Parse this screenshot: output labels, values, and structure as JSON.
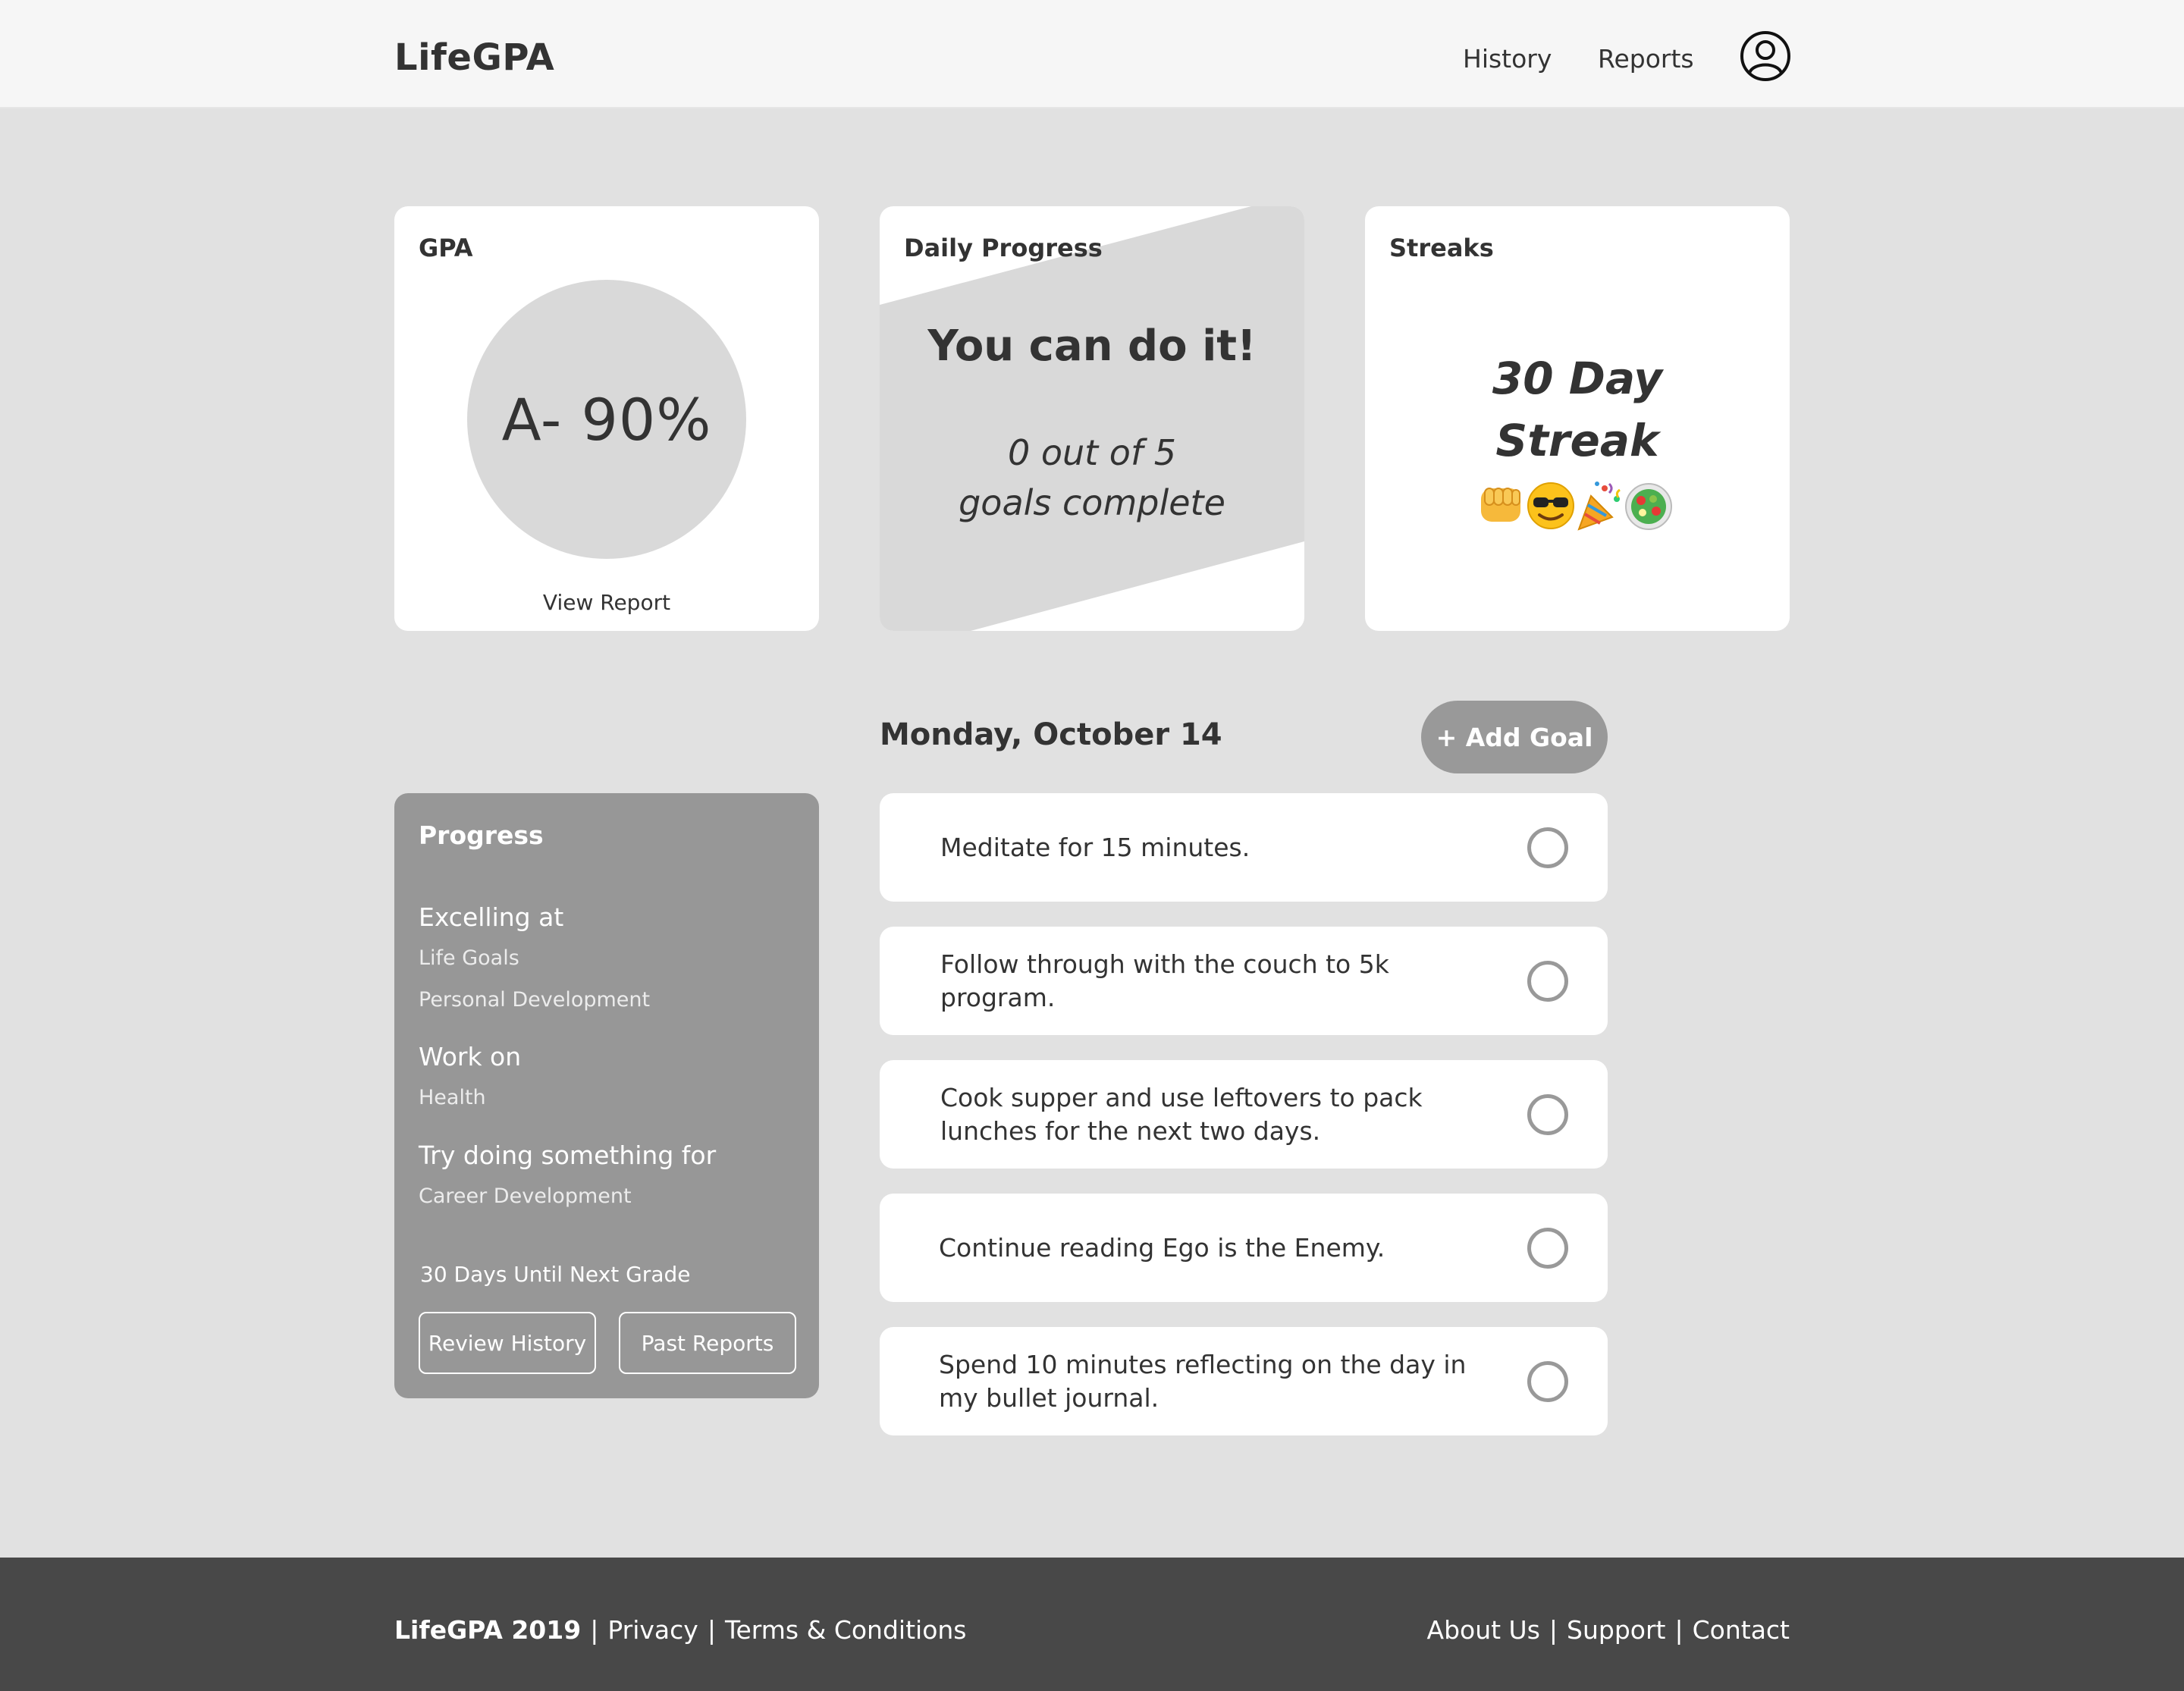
{
  "header": {
    "brand": "LifeGPA",
    "nav": {
      "history": "History",
      "reports": "Reports"
    }
  },
  "gpa_card": {
    "title": "GPA",
    "value": "A- 90%",
    "link": "View Report"
  },
  "daily_progress": {
    "title": "Daily Progress",
    "message": "You can do it!",
    "count_line1": "0 out of 5",
    "count_line2": "goals complete"
  },
  "streaks": {
    "title": "Streaks",
    "line1": "30 Day",
    "line2": "Streak",
    "icons": [
      "fist-emoji",
      "sunglasses-emoji",
      "party-popper-emoji",
      "salad-emoji"
    ]
  },
  "progress": {
    "title": "Progress",
    "excelling_heading": "Excelling at",
    "excelling_items": [
      "Life Goals",
      "Personal Development"
    ],
    "work_heading": "Work on",
    "work_items": [
      "Health"
    ],
    "try_heading": "Try doing something for",
    "try_items": [
      "Career Development"
    ],
    "next_grade": "30 Days Until Next Grade",
    "review_button": "Review History",
    "past_button": "Past Reports"
  },
  "goals": {
    "date": "Monday, October 14",
    "add_button": "+ Add Goal",
    "items": [
      {
        "text": "Meditate for 15 minutes.",
        "done": false
      },
      {
        "text": "Follow through with the couch to 5k program.",
        "done": false
      },
      {
        "text": "Cook supper and use leftovers to pack lunches for the next two days.",
        "done": false
      },
      {
        "text": "Continue reading Ego is the Enemy.",
        "done": false
      },
      {
        "text": "Spend 10 minutes reflecting on the day in my bullet journal.",
        "done": false
      }
    ]
  },
  "footer": {
    "brand": "LifeGPA 2019",
    "privacy": "Privacy",
    "terms": "Terms & Conditions",
    "about": "About Us",
    "support": "Support",
    "contact": "Contact",
    "separator": "|"
  },
  "colors": {
    "page_bg": "#e1e1e1",
    "header_bg": "#f6f6f6",
    "card_bg": "#ffffff",
    "shape_gray": "#d9d9d9",
    "panel_gray": "#979797",
    "button_gray": "#999999",
    "footer_bg": "#484848",
    "text_dark": "#333333"
  }
}
